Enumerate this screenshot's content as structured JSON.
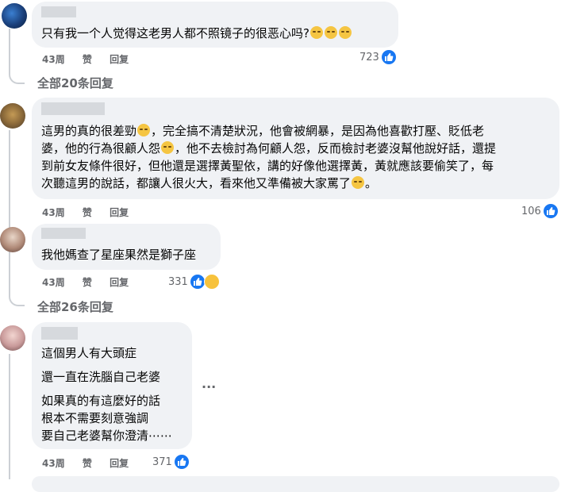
{
  "comments": [
    {
      "text": "只有我一个人觉得这老男人都不照镜子的很恶心吗?",
      "time": "43周",
      "like_label": "赞",
      "reply_label": "回复",
      "likes": "723"
    },
    {
      "text1": "這男的真的很差勁",
      "text2": "，完全搞不清楚狀況，他會被網暴，是因為他喜歡打壓、貶低老",
      "text3": "婆，他的行為很顧人怨",
      "text4": "，他不去檢討為何顧人怨，反而檢討老婆沒幫他說好話，還提",
      "text5": "到前女友條件很好，但他還是選擇黃聖依，講的好像他選擇黃，黃就應該要偷笑了，每",
      "text6": "次聽這男的說話，都讓人很火大，看來他又準備被大家罵了",
      "text7": "。",
      "time": "43周",
      "like_label": "赞",
      "reply_label": "回复",
      "likes": "106"
    },
    {
      "text": "我他媽查了星座果然是獅子座",
      "time": "43周",
      "like_label": "赞",
      "reply_label": "回复",
      "likes": "331"
    },
    {
      "line1": "這個男人有大頭症",
      "line2": "還一直在洗腦自己老婆",
      "line3": "如果真的有這麼好的話",
      "line4": "根本不需要刻意強調",
      "line5": "要自己老婆幫你澄清⋯⋯",
      "more": "···",
      "time": "43周",
      "like_label": "赞",
      "reply_label": "回复",
      "likes": "371"
    }
  ],
  "thread": {
    "all_replies_1": "全部20条回复",
    "all_replies_2": "全部26条回复"
  },
  "colors": {
    "like_blue": "#1877f2",
    "bubble_gray": "#f0f2f5",
    "meta_gray": "#65676b"
  },
  "icons": [
    "like-icon",
    "haha-icon",
    "emoji-icon",
    "more-icon"
  ]
}
